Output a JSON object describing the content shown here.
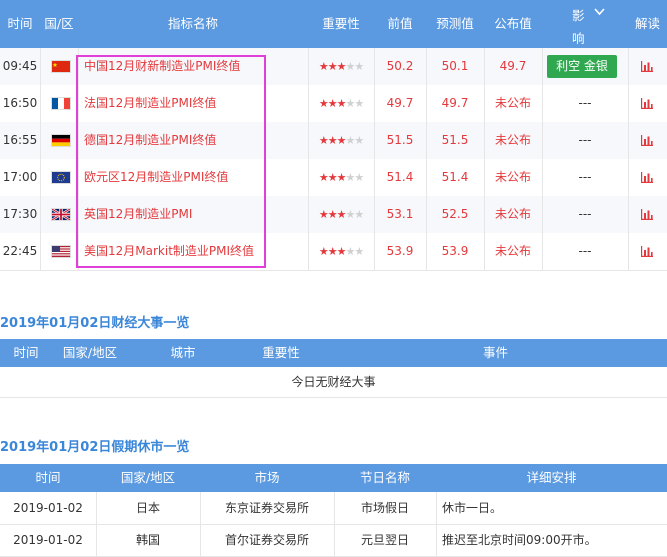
{
  "header": {
    "time": "时间",
    "region": "国/区",
    "indicator": "指标名称",
    "importance": "重要性",
    "previous": "前值",
    "forecast": "预测值",
    "published": "公布值",
    "impact_top": "影",
    "impact_bottom": "响",
    "explain": "解读"
  },
  "rows": [
    {
      "time": "09:45",
      "flag": "china",
      "name": "中国12月财新制造业PMI终值",
      "stars": 3,
      "previous": "50.2",
      "forecast": "50.1",
      "published": "49.7",
      "impact": "利空 金银",
      "explain_icon": "bar-chart-icon"
    },
    {
      "time": "16:50",
      "flag": "france",
      "name": "法国12月制造业PMI终值",
      "stars": 3,
      "previous": "49.7",
      "forecast": "49.7",
      "published": "未公布",
      "impact": "---",
      "explain_icon": "bar-chart-icon"
    },
    {
      "time": "16:55",
      "flag": "germany",
      "name": "德国12月制造业PMI终值",
      "stars": 3,
      "previous": "51.5",
      "forecast": "51.5",
      "published": "未公布",
      "impact": "---",
      "explain_icon": "bar-chart-icon"
    },
    {
      "time": "17:00",
      "flag": "eu",
      "name": "欧元区12月制造业PMI终值",
      "stars": 3,
      "previous": "51.4",
      "forecast": "51.4",
      "published": "未公布",
      "impact": "---",
      "explain_icon": "bar-chart-icon"
    },
    {
      "time": "17:30",
      "flag": "uk",
      "name": "英国12月制造业PMI",
      "stars": 3,
      "previous": "53.1",
      "forecast": "52.5",
      "published": "未公布",
      "impact": "---",
      "explain_icon": "bar-chart-icon"
    },
    {
      "time": "22:45",
      "flag": "usa",
      "name": "美国12月Markit制造业PMI终值",
      "stars": 3,
      "previous": "53.9",
      "forecast": "53.9",
      "published": "未公布",
      "impact": "---",
      "explain_icon": "bar-chart-icon"
    }
  ],
  "events": {
    "title": "2019年01月02日财经大事一览",
    "headers": {
      "time": "时间",
      "region": "国家/地区",
      "city": "城市",
      "importance": "重要性",
      "event": "事件"
    },
    "empty": "今日无财经大事"
  },
  "holidays": {
    "title": "2019年01月02日假期休市一览",
    "headers": {
      "time": "时间",
      "region": "国家/地区",
      "market": "市场",
      "holiday": "节日名称",
      "details": "详细安排"
    },
    "rows": [
      {
        "time": "2019-01-02",
        "region": "日本",
        "market": "东京证券交易所",
        "holiday": "市场假日",
        "details": "休市一日。"
      },
      {
        "time": "2019-01-02",
        "region": "韩国",
        "market": "首尔证券交易所",
        "holiday": "元旦翌日",
        "details": "推迟至北京时间09:00开市。"
      }
    ]
  },
  "colors": {
    "header": "#5b9ae0",
    "accent_red": "#e4393c",
    "badge_green": "#2fa84f",
    "highlight": "#e040d8"
  }
}
